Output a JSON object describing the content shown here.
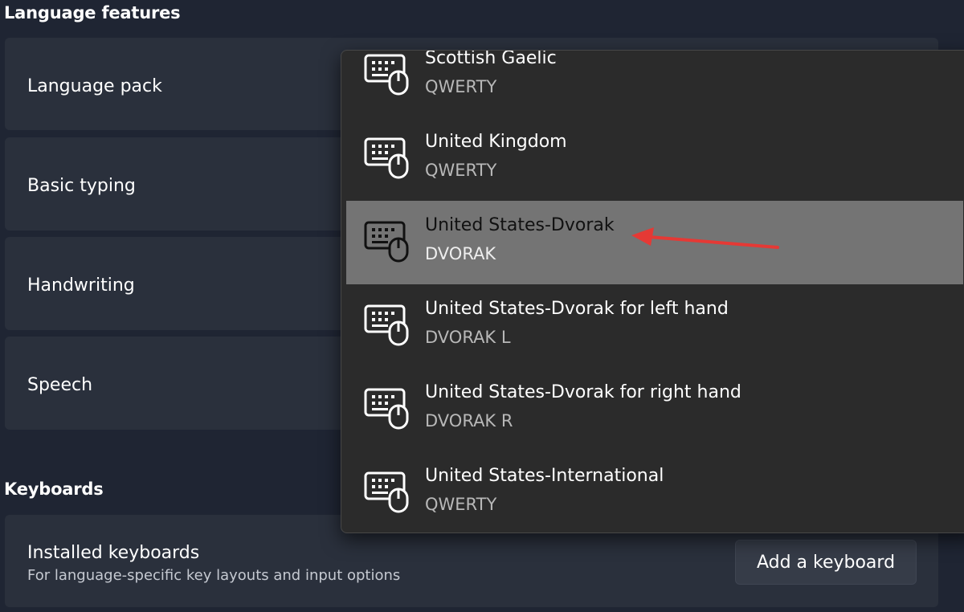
{
  "language_features": {
    "title": "Language features",
    "items": [
      {
        "label": "Language pack"
      },
      {
        "label": "Basic typing"
      },
      {
        "label": "Handwriting"
      },
      {
        "label": "Speech"
      }
    ]
  },
  "keyboards": {
    "title": "Keyboards",
    "installed_label": "Installed keyboards",
    "installed_desc": "For language-specific key layouts and input options",
    "add_button": "Add a keyboard"
  },
  "dropdown": {
    "items": [
      {
        "name": "Scottish Gaelic",
        "layout": "QWERTY",
        "icon": "keyboard-mouse-icon"
      },
      {
        "name": "United Kingdom",
        "layout": "QWERTY",
        "icon": "keyboard-mouse-icon"
      },
      {
        "name": "United States-Dvorak",
        "layout": "DVORAK",
        "icon": "keyboard-mouse-icon",
        "highlighted": true
      },
      {
        "name": "United States-Dvorak for left hand",
        "layout": "DVORAK L",
        "icon": "keyboard-mouse-icon"
      },
      {
        "name": "United States-Dvorak for right hand",
        "layout": "DVORAK R",
        "icon": "keyboard-mouse-icon"
      },
      {
        "name": "United States-International",
        "layout": "QWERTY",
        "icon": "keyboard-mouse-icon"
      }
    ]
  },
  "colors": {
    "background": "#1f2533",
    "card": "#2a303c",
    "dropdown": "#2b2b2b",
    "highlight": "#747474",
    "annotation_arrow": "#e53935"
  }
}
